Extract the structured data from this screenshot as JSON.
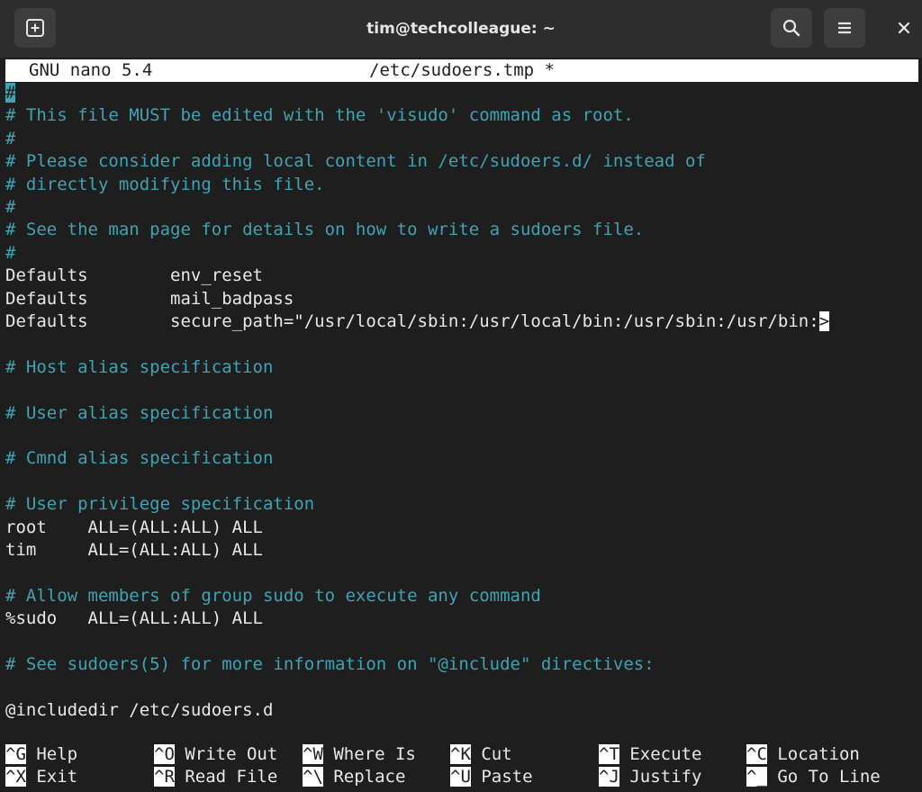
{
  "window": {
    "title": "tim@techcolleague: ~",
    "new_tab_icon": "new-tab-icon",
    "search_icon": "search-icon",
    "menu_icon": "hamburger-menu-icon",
    "close_icon": "close-icon"
  },
  "nano": {
    "version": "GNU nano 5.4",
    "file": "/etc/sudoers.tmp *"
  },
  "editor": {
    "cursor_char": "#",
    "lines": [
      {
        "text": "",
        "kind": "comment"
      },
      {
        "text": "# This file MUST be edited with the 'visudo' command as root.",
        "kind": "comment"
      },
      {
        "text": "#",
        "kind": "comment"
      },
      {
        "text": "# Please consider adding local content in /etc/sudoers.d/ instead of",
        "kind": "comment"
      },
      {
        "text": "# directly modifying this file.",
        "kind": "comment"
      },
      {
        "text": "#",
        "kind": "comment"
      },
      {
        "text": "# See the man page for details on how to write a sudoers file.",
        "kind": "comment"
      },
      {
        "text": "#",
        "kind": "comment"
      },
      {
        "text": "Defaults        env_reset",
        "kind": "normal"
      },
      {
        "text": "Defaults        mail_badpass",
        "kind": "normal"
      },
      {
        "text": "Defaults        secure_path=\"/usr/local/sbin:/usr/local/bin:/usr/sbin:/usr/bin:",
        "kind": "normal"
      },
      {
        "text": "",
        "kind": "normal"
      },
      {
        "text": "# Host alias specification",
        "kind": "comment"
      },
      {
        "text": "",
        "kind": "normal"
      },
      {
        "text": "# User alias specification",
        "kind": "comment"
      },
      {
        "text": "",
        "kind": "normal"
      },
      {
        "text": "# Cmnd alias specification",
        "kind": "comment"
      },
      {
        "text": "",
        "kind": "normal"
      },
      {
        "text": "# User privilege specification",
        "kind": "comment"
      },
      {
        "text": "root    ALL=(ALL:ALL) ALL",
        "kind": "normal"
      },
      {
        "text": "tim     ALL=(ALL:ALL) ALL",
        "kind": "normal"
      },
      {
        "text": "",
        "kind": "normal"
      },
      {
        "text": "# Allow members of group sudo to execute any command",
        "kind": "comment"
      },
      {
        "text": "%sudo   ALL=(ALL:ALL) ALL",
        "kind": "normal"
      },
      {
        "text": "",
        "kind": "normal"
      },
      {
        "text": "# See sudoers(5) for more information on \"@include\" directives:",
        "kind": "comment"
      },
      {
        "text": "",
        "kind": "normal"
      },
      {
        "text": "@includedir /etc/sudoers.d",
        "kind": "normal"
      }
    ],
    "overflow_marker": ">"
  },
  "shortcuts": [
    {
      "key": "^G",
      "label": " Help"
    },
    {
      "key": "^O",
      "label": " Write Out"
    },
    {
      "key": "^W",
      "label": " Where Is"
    },
    {
      "key": "^K",
      "label": " Cut"
    },
    {
      "key": "^T",
      "label": " Execute"
    },
    {
      "key": "^C",
      "label": " Location"
    },
    {
      "key": "^X",
      "label": " Exit"
    },
    {
      "key": "^R",
      "label": " Read File"
    },
    {
      "key": "^\\",
      "label": " Replace"
    },
    {
      "key": "^U",
      "label": " Paste"
    },
    {
      "key": "^J",
      "label": " Justify"
    },
    {
      "key": "^_",
      "label": " Go To Line"
    }
  ]
}
